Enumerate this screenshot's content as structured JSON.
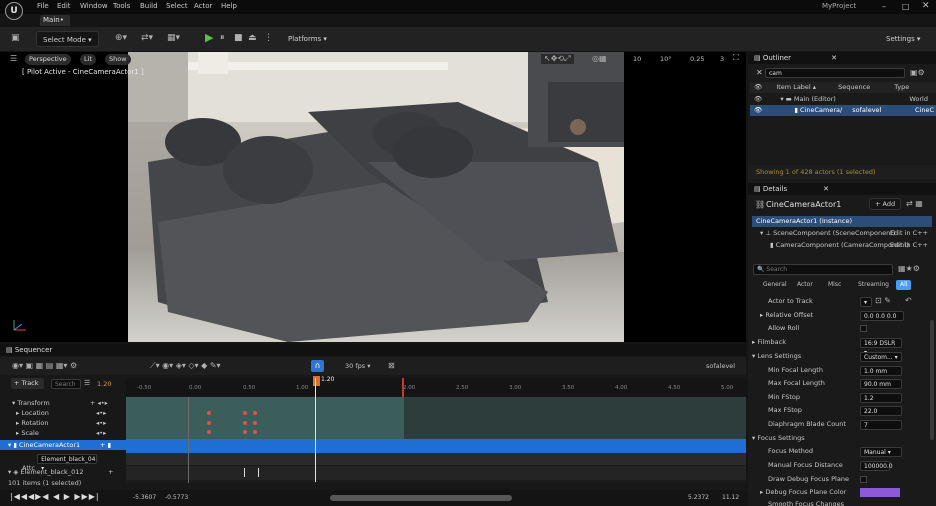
{
  "app": {
    "logo": "U",
    "project": "MyProject",
    "tab": "Main•"
  },
  "menu": [
    "File",
    "Edit",
    "Window",
    "Tools",
    "Build",
    "Select",
    "Actor",
    "Help"
  ],
  "toolbar": {
    "select_mode": "Select Mode ▾",
    "platforms": "Platforms ▾",
    "settings": "Settings ▾"
  },
  "viewport": {
    "perspective": "Perspective",
    "lit": "Lit",
    "show": "Show",
    "pilot": "[ Pilot Active - CineCameraActor1 ]",
    "grid": "10",
    "angle": "10°",
    "scale": "0.25",
    "speed": "3"
  },
  "outliner": {
    "title": "Outliner",
    "search": "cam",
    "col_label": "Item Label ▴",
    "col_seq": "Sequence",
    "col_type": "Type",
    "rows": [
      {
        "label": "Main (Editor)",
        "seq": "",
        "type": "World"
      },
      {
        "label": "CineCamera/",
        "seq": "sofalevel",
        "type": "CineC"
      }
    ],
    "status": "Showing 1 of 428 actors (1 selected)"
  },
  "details": {
    "title": "Details",
    "actor": "CineCameraActor1",
    "add": "+ Add",
    "instance": "CineCameraActor1 (Instance)",
    "scene_comp": "SceneComponent (SceneComponent)",
    "cam_comp": "CameraComponent (CameraComponent)",
    "edit_cpp": "Edit in C++",
    "search": "Search",
    "tabs": [
      "General",
      "Actor",
      "Misc",
      "Streaming",
      "All"
    ],
    "props": [
      {
        "label": "Actor to Track",
        "value": "▾"
      },
      {
        "label": "Relative Offset",
        "value": "0.0  0.0  0.0"
      },
      {
        "label": "Allow Roll",
        "value": ""
      },
      {
        "label": "Filmback",
        "value": "16:9 DSLR ▾"
      },
      {
        "label": "Lens Settings",
        "value": "Custom... ▾"
      },
      {
        "label": "Min Focal Length",
        "value": "1.0 mm"
      },
      {
        "label": "Max Focal Length",
        "value": "90.0 mm"
      },
      {
        "label": "Min FStop",
        "value": "1.2"
      },
      {
        "label": "Max FStop",
        "value": "22.0"
      },
      {
        "label": "Diaphragm Blade Count",
        "value": "7"
      },
      {
        "label": "Focus Settings",
        "value": ""
      },
      {
        "label": "Focus Method",
        "value": "Manual ▾"
      },
      {
        "label": "Manual Focus Distance",
        "value": "100000.0"
      },
      {
        "label": "Draw Debug Focus Plane",
        "value": ""
      },
      {
        "label": "Debug Focus Plane Color",
        "value": ""
      },
      {
        "label": "Smooth Focus Changes",
        "value": ""
      }
    ]
  },
  "sequencer": {
    "title": "Sequencer",
    "fps": "30 fps ▾",
    "track": "+ Track",
    "search": "Search",
    "time": "1.20",
    "level": "sofalevel",
    "ruler": [
      "-0.50",
      "0.00",
      "0.50",
      "1.00",
      "1.20",
      "2.00",
      "2.50",
      "3.00",
      "3.50",
      "4.00",
      "4.50",
      "5.00"
    ],
    "tracks": [
      {
        "label": "Transform"
      },
      {
        "label": "Location"
      },
      {
        "label": "Rotation"
      },
      {
        "label": "Scale"
      },
      {
        "label": "CineCameraActor1"
      },
      {
        "label": "Element_black_04 ▾"
      },
      {
        "label": "Element_black_012"
      }
    ],
    "attach": "Attc",
    "items": "101 items (1 selected)",
    "bottom": {
      "start": "-5.3607",
      "in": "-0.5773",
      "out": "5.2372",
      "end": "11.12"
    }
  },
  "colors": {
    "accent": "#4a9cff",
    "selection": "#1f6ed4",
    "play": "#56c24b"
  }
}
